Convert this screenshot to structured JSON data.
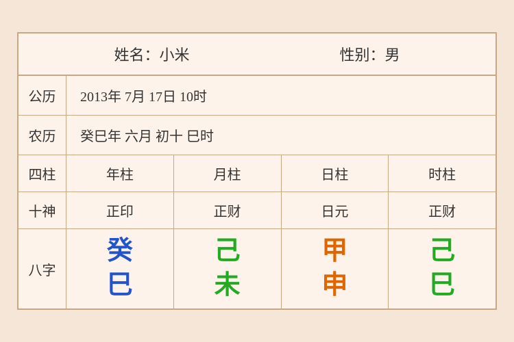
{
  "header": {
    "name_label": "姓名：小米",
    "gender_label": "性别：男"
  },
  "solar": {
    "label": "公历",
    "value": "2013年 7月 17日 10时"
  },
  "lunar": {
    "label": "农历",
    "value": "癸巳年 六月 初十 巳时"
  },
  "pillars": {
    "label": "四柱",
    "year": "年柱",
    "month": "月柱",
    "day": "日柱",
    "hour": "时柱"
  },
  "shishen": {
    "label": "十神",
    "year": "正印",
    "month": "正财",
    "day": "日元",
    "hour": "正财"
  },
  "bazi": {
    "label": "八字",
    "year_top": "癸",
    "year_bottom": "巳",
    "month_top": "己",
    "month_bottom": "未",
    "day_top": "甲",
    "day_bottom": "申",
    "hour_top": "己",
    "hour_bottom": "巳"
  }
}
